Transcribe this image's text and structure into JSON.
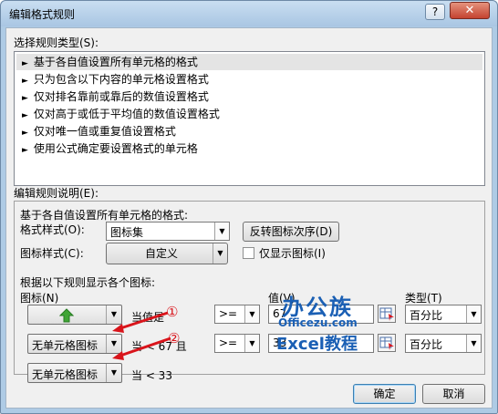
{
  "window": {
    "title": "编辑格式规则",
    "help_label": "?",
    "close_label": "✕"
  },
  "rule_type": {
    "label": "选择规则类型(S):",
    "items": [
      {
        "label": "基于各自值设置所有单元格的格式",
        "selected": true
      },
      {
        "label": "只为包含以下内容的单元格设置格式",
        "selected": false
      },
      {
        "label": "仅对排名靠前或靠后的数值设置格式",
        "selected": false
      },
      {
        "label": "仅对高于或低于平均值的数值设置格式",
        "selected": false
      },
      {
        "label": "仅对唯一值或重复值设置格式",
        "selected": false
      },
      {
        "label": "使用公式确定要设置格式的单元格",
        "selected": false
      }
    ],
    "bullet": "►"
  },
  "rule_desc": {
    "label": "编辑规则说明(E):",
    "intro": "基于各自值设置所有单元格的格式:",
    "format_style_label": "格式样式(O):",
    "format_style_value": "图标集",
    "reverse_button": "反转图标次序(D)",
    "icon_style_label": "图标样式(C):",
    "icon_style_value": "自定义",
    "show_icon_only_label": "仅显示图标(I)",
    "show_icon_only_checked": false,
    "rules_heading": "根据以下规则显示各个图标:",
    "col_icon": "图标(N)",
    "col_value": "值(V)",
    "col_type": "类型(T)",
    "rows": [
      {
        "icon_label": "",
        "icon_name": "green-up-arrow-icon",
        "condition": "当值是",
        "operator": ">=",
        "value": "67",
        "type": "百分比"
      },
      {
        "icon_label": "无单元格图标",
        "icon_name": "",
        "condition": "当 < 67 且",
        "operator": ">=",
        "value": "33",
        "type": "百分比"
      },
      {
        "icon_label": "无单元格图标",
        "icon_name": "",
        "condition": "当 < 33",
        "operator": "",
        "value": "",
        "type": ""
      }
    ]
  },
  "annotations": {
    "marker_1": "①",
    "marker_2": "②",
    "arrow_color": "#d9141b"
  },
  "watermark": {
    "brand": "办公族",
    "domain": "Officezu.com",
    "tagline": "Excel教程"
  },
  "footer": {
    "ok_label": "确定",
    "cancel_label": "取消"
  },
  "colors": {
    "titlebar": "#aecbe5",
    "close_button": "#c44330",
    "selection": "#e4e4e4",
    "green_arrow": "#3fa535",
    "watermark_blue": "#1a5fb4"
  }
}
